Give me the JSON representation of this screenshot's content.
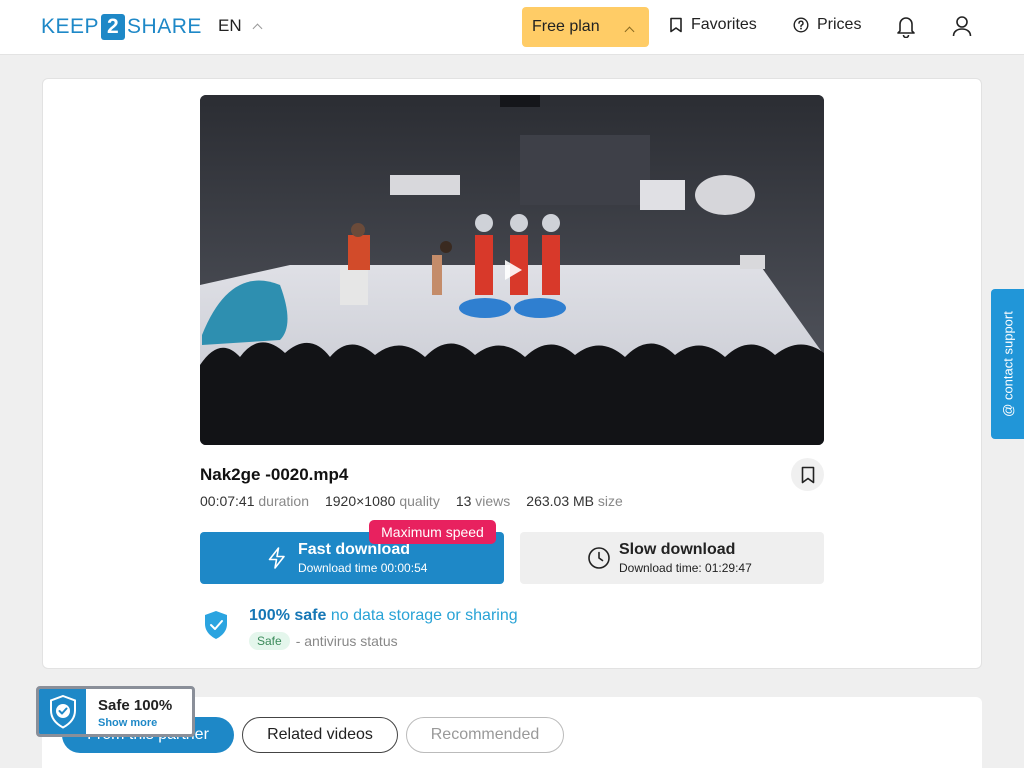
{
  "header": {
    "logo": {
      "left": "KEEP",
      "mid": "2",
      "right": "SHARE"
    },
    "language": "EN",
    "plan_label": "Free plan",
    "favorites_label": "Favorites",
    "prices_label": "Prices"
  },
  "file": {
    "name": "Nak2ge -0020.mp4",
    "duration_value": "00:07:41",
    "duration_label": "duration",
    "quality_value": "1920×1080",
    "quality_label": "quality",
    "views_value": "13",
    "views_label": "views",
    "size_value": "263.03 MB",
    "size_label": "size"
  },
  "download": {
    "fast_title": "Fast download",
    "fast_time": "Download time 00:00:54",
    "max_speed_badge": "Maximum speed",
    "slow_title": "Slow download",
    "slow_time": "Download time: 01:29:47"
  },
  "safety": {
    "strong": "100% safe",
    "light": "no data storage or sharing",
    "pill": "Safe",
    "antivirus": "- antivirus status"
  },
  "support": {
    "label": "@ contact support"
  },
  "tabs": [
    "From this partner",
    "Related videos",
    "Recommended"
  ],
  "badge": {
    "title": "Safe 100%",
    "link": "Show more"
  },
  "colors": {
    "accent": "#1e88c7",
    "plan": "#ffcc66",
    "max_speed": "#e8215f"
  }
}
